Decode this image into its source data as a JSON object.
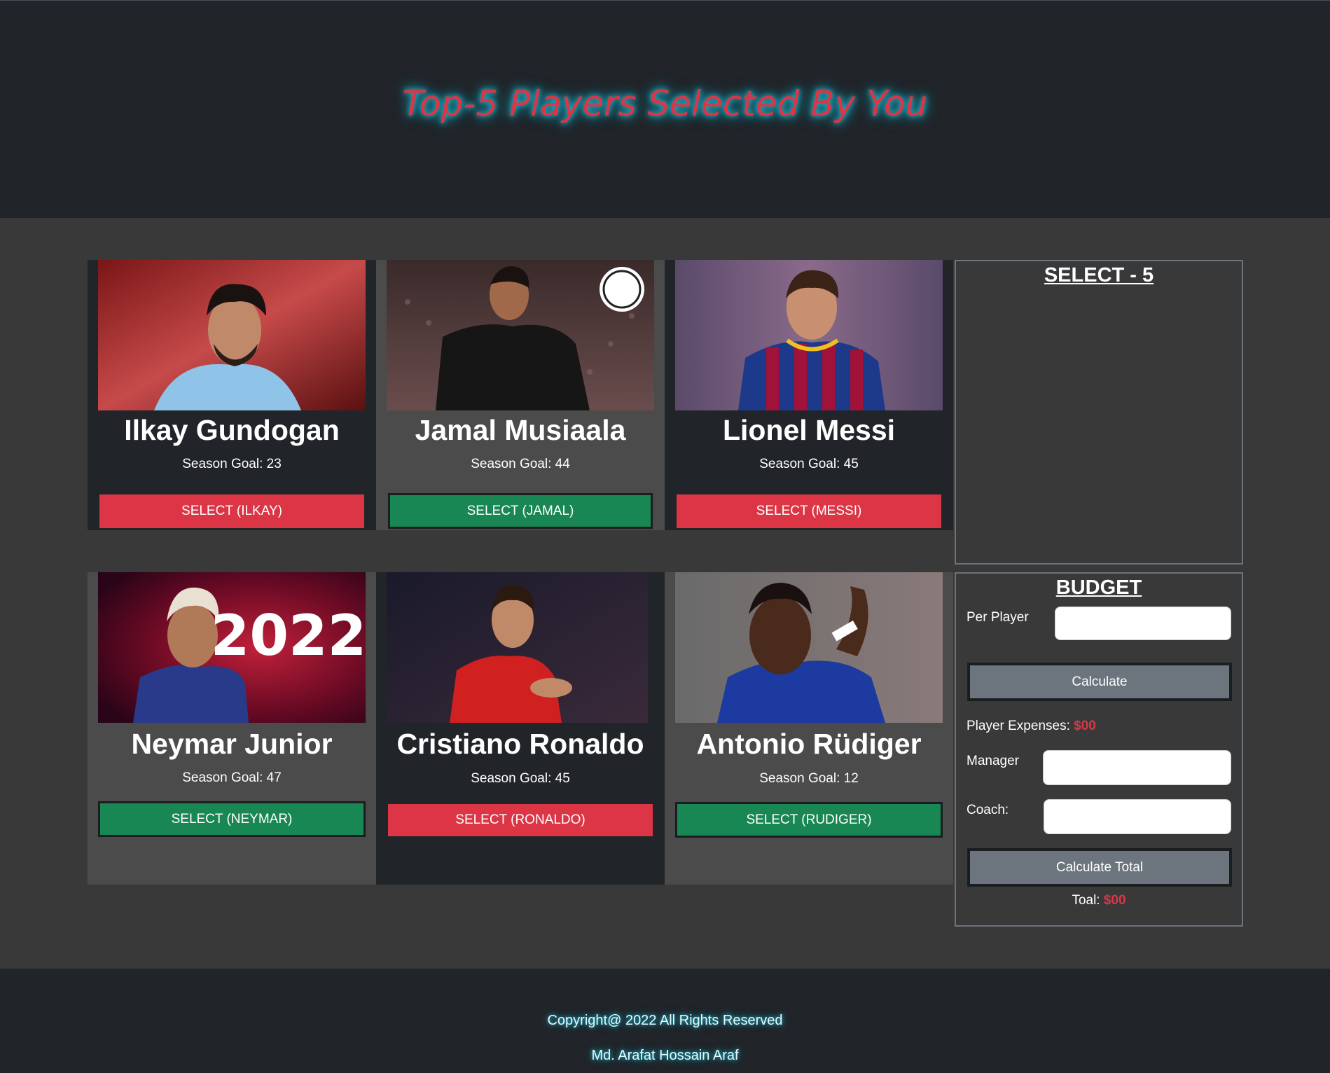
{
  "header": {
    "title": "Top-5 Players Selected By You"
  },
  "players": [
    {
      "name": "Ilkay Gundogan",
      "goal": "Season Goal: 23",
      "button": "SELECT (ILKAY)"
    },
    {
      "name": "Jamal Musiaala",
      "goal": "Season Goal: 44",
      "button": "SELECT (JAMAL)"
    },
    {
      "name": "Lionel Messi",
      "goal": "Season Goal: 45",
      "button": "SELECT (MESSI)"
    },
    {
      "name": "Neymar Junior",
      "goal": "Season Goal: 47",
      "button": "SELECT (NEYMAR)",
      "photo_text": "2022"
    },
    {
      "name": "Cristiano Ronaldo",
      "goal": "Season Goal: 45",
      "button": "SELECT (RONALDO)"
    },
    {
      "name": "Antonio Rüdiger",
      "goal": "Season Goal: 12",
      "button": "SELECT (RUDIGER)"
    }
  ],
  "select_panel": {
    "title": "SELECT - 5"
  },
  "budget": {
    "title": "BUDGET",
    "per_player_label": "Per Player",
    "calculate_label": "Calculate",
    "player_expenses_label": "Player Expenses:",
    "player_expenses_value": "$00",
    "manager_label": "Manager",
    "coach_label": "Coach:",
    "calculate_total_label": "Calculate Total",
    "total_label": "Toal:",
    "total_value": "$00"
  },
  "footer": {
    "copyright": "Copyright@ 2022 All Rights Reserved",
    "author": "Md. Arafat Hossain Araf"
  },
  "colors": {
    "danger": "#dc3545",
    "success": "#198754",
    "secondary": "#6c757d",
    "dark": "#212529",
    "glow": "#20c7e0"
  }
}
